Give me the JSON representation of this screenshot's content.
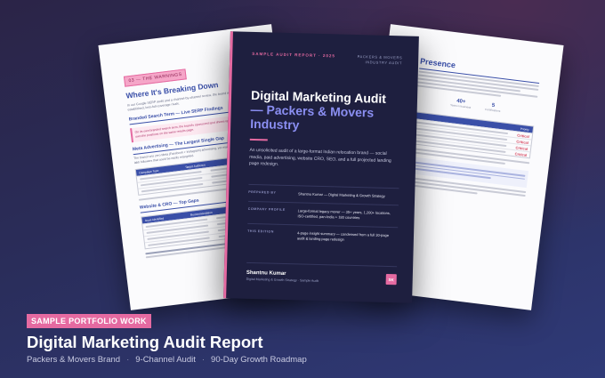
{
  "left_doc": {
    "tag": "03 — THE WARNINGS",
    "heading": "Where It's Breaking Down",
    "intro": "In our Google SERP audit and a channel-by-channel review, the brand is losing ground to less-established, less-full-coverage rivals.",
    "section1": "Branded Search Term — Live SERP Findings",
    "callout": "On its own branded search term, the brand's sponsored spot shows up only partially. Competitors own the positions on the same results page.",
    "section2": "Meta Advertising — The Largest Single Gap",
    "section2_text": "The brand runs zero Meta (Facebook + Instagram) advertising, yet maintains an organic audience of 2.8 lakh followers that could be easily retargeted.",
    "table1_header": [
      "Campaign Type",
      "Target Audience"
    ],
    "section3": "Website & CRO — Top Gaps",
    "table2_header": [
      "Issue Identified",
      "Recommendation"
    ]
  },
  "right_doc": {
    "heading": "Presence",
    "stat1_value": "40+",
    "stat1_label": "Years in business",
    "stat2_value": "5",
    "stat2_label": "Certifications",
    "priority_label": "Priority",
    "priority_items": [
      "Critical",
      "Critical",
      "Critical",
      "Critical"
    ]
  },
  "cover": {
    "label": "SAMPLE AUDIT REPORT · 2025",
    "brand": "PACKERS & MOVERS INDUSTRY AUDIT",
    "title_line1": "Digital Marketing Audit",
    "title_line2": "— Packers & Movers",
    "title_line3": "Industry",
    "description": "An unsolicited audit of a large-format Indian relocation brand — social media, paid advertising, website CRO, SEO, and a full projected landing page redesign.",
    "meta": [
      {
        "key": "PREPARED BY",
        "value": "Shantnu Kumar — Digital Marketing & Growth Strategy"
      },
      {
        "key": "COMPANY PROFILE",
        "value": "Large-format legacy mover — 35+ years, 1,200+ locations, ISO-certified, pan-India + 180 countries"
      },
      {
        "key": "THIS EDITION",
        "value": "4-page insight summary — condensed from a full 30-page audit & landing page redesign"
      }
    ],
    "author": "Shantnu Kumar",
    "author_role": "Digital Marketing & Growth Strategy · Sample Audit",
    "badge": "SK"
  },
  "footer": {
    "portfolio_tag": "SAMPLE PORTFOLIO WORK",
    "title": "Digital Marketing Audit Report",
    "subtitle_items": [
      "Packers & Movers Brand",
      "9-Channel Audit",
      "90-Day Growth Roadmap"
    ],
    "separator": "·"
  }
}
